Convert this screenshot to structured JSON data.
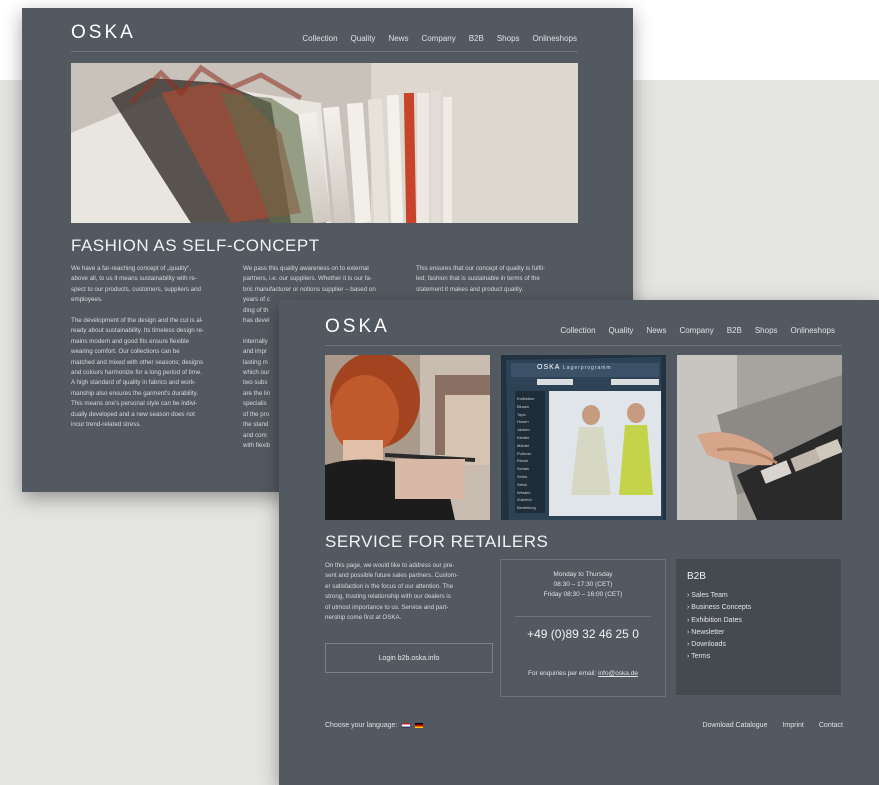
{
  "back_page": {
    "logo": "OSKA",
    "nav": [
      "Collection",
      "Quality",
      "News",
      "Company",
      "B2B",
      "Shops",
      "Onlineshops"
    ],
    "heading": "FASHION AS SELF-CONCEPT",
    "col1": "We have a far-reaching concept of „quality“,\nabove all, to us it means sustainability with re-\nspect to our products, customers, suppliers and\nemployees.\n\nThe development of the design and the cut is al-\nready about sustainability. Its timeless design re-\nmains modern and good fits ensure flexible\nwearing comfort. Our collections can be\nmatched and mixed with other seasons; designs\nand colours harmonize for a long period of time.\nA high standard of quality in fabrics and work-\nmanship also ensures the garment's durability.\nThis means one's personal style can be indivi-\ndually developed and a new season does not\nincur trend-related stress.",
    "col2": "We pass this quality awareness on to external\npartners, i.e. our suppliers. Whether it is our fa-\nbric manufacturer or notions supplier – based on\nyears of c\nding of th\nhas devel\n\ninternally\nand impr\nlasting m\nwhich our\ntwo subs\nare the lin\nspecialis\nof the pro\nthe stand\nand com\nwith flexib",
    "col3": "This ensures that our concept of quality is fulfil-\nled; fashion that is sustainable in terms of the\nstatement it makes and product quality."
  },
  "front_page": {
    "logo": "OSKA",
    "nav": [
      "Collection",
      "Quality",
      "News",
      "Company",
      "B2B",
      "Shops",
      "Onlineshops"
    ],
    "heading": "SERVICE FOR RETAILERS",
    "intro": "On this page, we would like to address our pre-\nsent and possible future sales partners. Custom-\ner satisfaction is the focus of our attention. The\nstrong, trusting relationship with our dealers is\nof utmost importance to us. Service and part-\nnership come first at OSKA.",
    "login_label": "Login b2b.oska.info",
    "hours": {
      "days": "Monday to Thursday",
      "time1": "08:30 – 17:30 (CET)",
      "time2": "Friday 08:30 – 16:00 (CET)",
      "phone": "+49 (0)89 32 46 25 0",
      "email_prefix": "For enquiries per email:",
      "email": "info@oska.de"
    },
    "b2b": {
      "title": "B2B",
      "links": [
        "› Sales Team",
        "› Business Concepts",
        "› Exhibition Dates",
        "› Newsletter",
        "› Downloads",
        "› Terms"
      ]
    },
    "screen_ui": {
      "brand": "OSKA",
      "tagline": "Lagerprogramm",
      "sidebar": [
        "Kollektion",
        "Blusen",
        "Tops",
        "Hosen",
        "Jacken",
        "Kleider",
        "Mäntel",
        "Pullover",
        "Röcke",
        "Schals",
        "Shirts",
        "Strick",
        "Westen",
        "Zubehör",
        "Bestellung"
      ]
    },
    "footer": {
      "language_label": "Choose your language:",
      "links": [
        "Download Catalogue",
        "Imprint",
        "Contact"
      ]
    }
  }
}
